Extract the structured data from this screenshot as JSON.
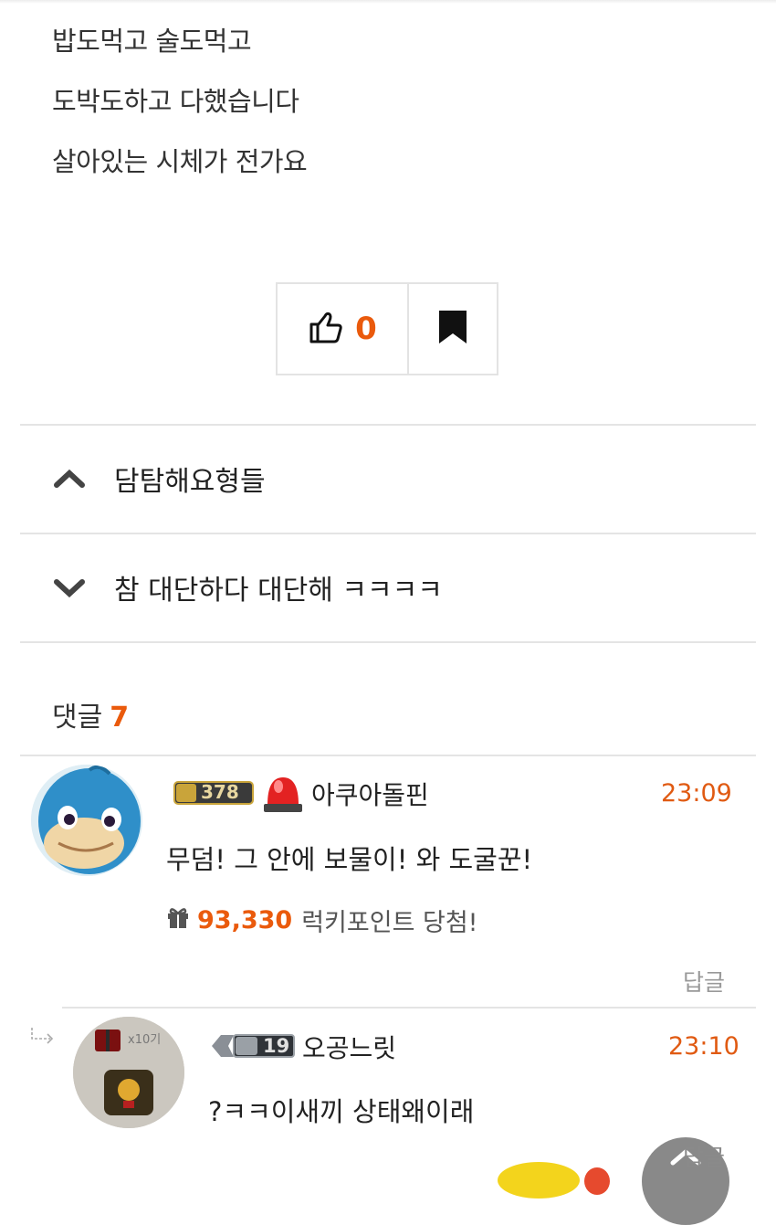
{
  "post": {
    "lines": [
      "밥도먹고 술도먹고",
      "도박도하고 다했습니다",
      "살아있는 시체가 전가요"
    ]
  },
  "actions": {
    "like_count": "0"
  },
  "navigation": {
    "prev_title": "담탐해요형들",
    "next_title": "참 대단하다 대단해 ㅋㅋㅋㅋ"
  },
  "comments": {
    "label": "댓글",
    "count": "7",
    "items": [
      {
        "rank": "378",
        "nickname": "아쿠아돌핀",
        "time": "23:09",
        "text": "무덤! 그 안에 보물이! 와 도굴꾼!",
        "lucky_points": "93,330",
        "lucky_text": "럭키포인트 당첨!",
        "reply_label": "답글"
      },
      {
        "rank": "19",
        "nickname": "오공느릿",
        "time": "23:10",
        "text": "?ㅋㅋ이새끼 상태왜이래",
        "avatar_text": "x10기",
        "reply_label": "답글"
      }
    ]
  },
  "colors": {
    "accent": "#ea5a0c",
    "time": "#e05a12"
  }
}
